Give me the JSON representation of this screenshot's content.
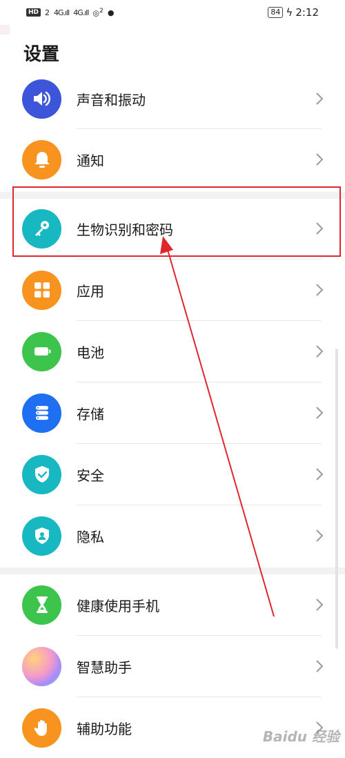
{
  "status_bar": {
    "hd": "HD",
    "sim": "2",
    "net1": "4G",
    "net2": "4G",
    "hotspot": "2",
    "battery": "84",
    "time": "2:12"
  },
  "page": {
    "title": "设置"
  },
  "items": [
    {
      "label": "声音和振动",
      "icon": "speaker-icon",
      "color": "#3d55d9"
    },
    {
      "label": "通知",
      "icon": "bell-icon",
      "color": "#f7931e"
    },
    {
      "label": "生物识别和密码",
      "icon": "key-icon",
      "color": "#17b8c2"
    },
    {
      "label": "应用",
      "icon": "apps-grid-icon",
      "color": "#f7931e"
    },
    {
      "label": "电池",
      "icon": "battery-icon",
      "color": "#3cc44c"
    },
    {
      "label": "存储",
      "icon": "storage-icon",
      "color": "#1f6ff2"
    },
    {
      "label": "安全",
      "icon": "shield-check-icon",
      "color": "#17b8c2"
    },
    {
      "label": "隐私",
      "icon": "privacy-shield-icon",
      "color": "#17b8c2"
    },
    {
      "label": "健康使用手机",
      "icon": "hourglass-icon",
      "color": "#3cc44c"
    },
    {
      "label": "智慧助手",
      "icon": "assistant-icon",
      "color": "#c78df0"
    },
    {
      "label": "辅助功能",
      "icon": "hand-icon",
      "color": "#f7931e"
    }
  ],
  "watermark": "Baidu 经验"
}
